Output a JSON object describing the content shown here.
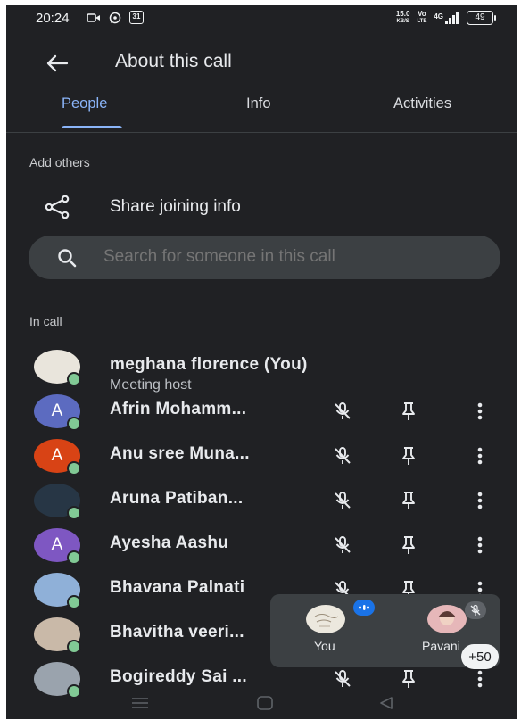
{
  "status": {
    "time": "20:24",
    "calendar_day": "31",
    "net_speed": "15.0",
    "net_unit": "KB/S",
    "volte_top": "Vo",
    "volte_bottom": "LTE",
    "network": "4G",
    "battery": "49"
  },
  "appbar": {
    "title": "About this call"
  },
  "tabs": [
    {
      "label": "People",
      "active": true
    },
    {
      "label": "Info",
      "active": false
    },
    {
      "label": "Activities",
      "active": false
    }
  ],
  "add_others": {
    "heading": "Add others",
    "share_label": "Share joining info"
  },
  "search": {
    "placeholder": "Search for someone in this call"
  },
  "in_call_heading": "In call",
  "participants": [
    {
      "name": "meghana florence (You)",
      "subtitle": "Meeting host",
      "avatar": "photo",
      "color": "#e9e5dc"
    },
    {
      "name": "Afrin Mohamm...",
      "initial": "A",
      "avatar": "letter",
      "color": "#5c6bc0"
    },
    {
      "name": "Anu sree Muna...",
      "initial": "A",
      "avatar": "letter",
      "color": "#d84315"
    },
    {
      "name": "Aruna Patiban...",
      "avatar": "photo",
      "color": "#273645"
    },
    {
      "name": "Ayesha Aashu",
      "initial": "A",
      "avatar": "letter",
      "color": "#7e57c2"
    },
    {
      "name": "Bhavana Palnati",
      "avatar": "photo",
      "color": "#8fb0d8"
    },
    {
      "name": "Bhavitha veeri...",
      "avatar": "photo",
      "color": "#c9b9a8"
    },
    {
      "name": "Bogireddy Sai ...",
      "avatar": "photo",
      "color": "#9aa3ad"
    }
  ],
  "pip": {
    "you_label": "You",
    "other_label": "Pavani",
    "more_count": "+50"
  },
  "colors": {
    "background": "#202124",
    "accent": "#8ab4f8",
    "online_dot": "#81c995",
    "speaking": "#1a73e8"
  }
}
